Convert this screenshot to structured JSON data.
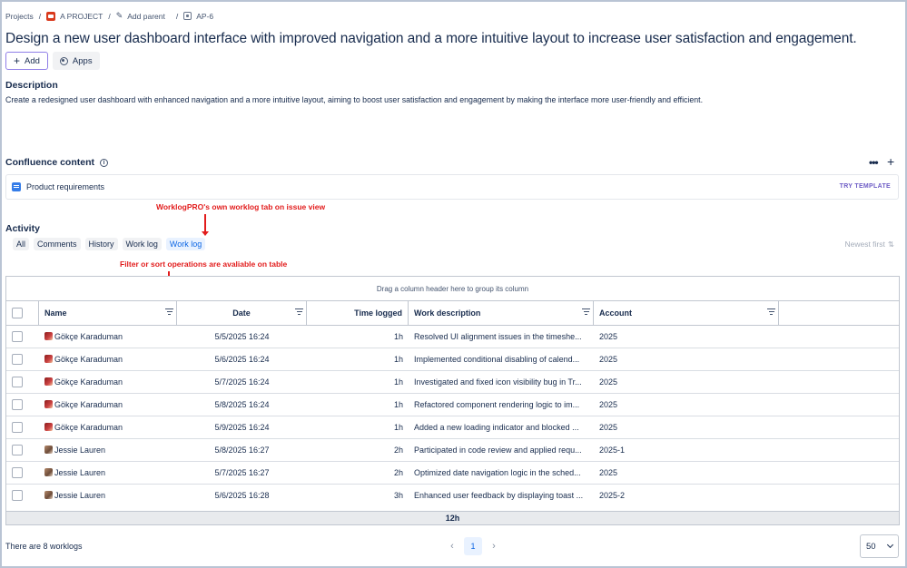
{
  "breadcrumb": {
    "projects": "Projects",
    "project": "A PROJECT",
    "add_parent": "Add parent",
    "issue_key": "AP-6",
    "separator": "/"
  },
  "issue": {
    "title": "Design a new user dashboard interface with improved navigation and a more intuitive layout to increase user satisfaction and engagement.",
    "add_label": "Add",
    "apps_label": "Apps",
    "description_heading": "Description",
    "description_text": "Create a redesigned user dashboard with enhanced navigation and a more intuitive layout, aiming to boost user satisfaction and engagement by making the interface more user-friendly and efficient."
  },
  "confluence": {
    "heading": "Confluence content",
    "item": "Product requirements",
    "try_template": "TRY TEMPLATE"
  },
  "annotations": {
    "tab_note": "WorklogPRO's own worklog tab on issue view",
    "filter_note": "Filter or sort operations are avaliable on table"
  },
  "activity": {
    "heading": "Activity",
    "tabs": [
      "All",
      "Comments",
      "History",
      "Work log",
      "Work log"
    ],
    "sort_label": "Newest first"
  },
  "table": {
    "group_hint": "Drag a column header here to group its column",
    "columns": [
      "Name",
      "Date",
      "Time logged",
      "Work description",
      "Account"
    ],
    "rows": [
      {
        "name": "Gökçe Karaduman",
        "date": "5/5/2025 16:24",
        "time": "1h",
        "desc": "Resolved UI alignment issues in the timeshe...",
        "account": "2025"
      },
      {
        "name": "Gökçe Karaduman",
        "date": "5/6/2025 16:24",
        "time": "1h",
        "desc": "Implemented conditional disabling of calend...",
        "account": "2025"
      },
      {
        "name": "Gökçe Karaduman",
        "date": "5/7/2025 16:24",
        "time": "1h",
        "desc": "Investigated and fixed icon visibility bug in Tr...",
        "account": "2025"
      },
      {
        "name": "Gökçe Karaduman",
        "date": "5/8/2025 16:24",
        "time": "1h",
        "desc": "Refactored component rendering logic to im...",
        "account": "2025"
      },
      {
        "name": "Gökçe Karaduman",
        "date": "5/9/2025 16:24",
        "time": "1h",
        "desc": "Added a new loading indicator and blocked ...",
        "account": "2025"
      },
      {
        "name": "Jessie Lauren",
        "date": "5/8/2025 16:27",
        "time": "2h",
        "desc": "Participated in code review and applied requ...",
        "account": "2025-1"
      },
      {
        "name": "Jessie Lauren",
        "date": "5/7/2025 16:27",
        "time": "2h",
        "desc": "Optimized date navigation logic in the sched...",
        "account": "2025"
      },
      {
        "name": "Jessie Lauren",
        "date": "5/6/2025 16:28",
        "time": "3h",
        "desc": "Enhanced user feedback by displaying toast ...",
        "account": "2025-2"
      }
    ],
    "total": "12h"
  },
  "footer": {
    "count_text": "There are 8 worklogs",
    "current_page": "1",
    "page_size": "50"
  }
}
